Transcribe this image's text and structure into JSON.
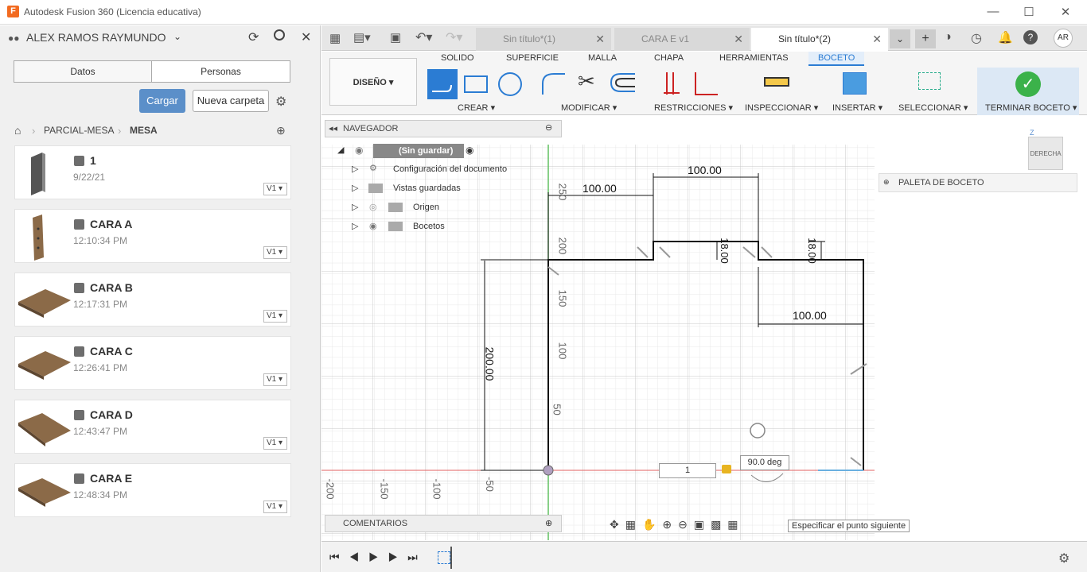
{
  "window": {
    "title": "Autodesk Fusion 360 (Licencia educativa)",
    "logo": "F",
    "minimize": "—",
    "maximize": "☐",
    "close": "✕"
  },
  "data_panel": {
    "user": "ALEX RAMOS RAYMUNDO",
    "tab_data": "Datos",
    "tab_people": "Personas",
    "upload": "Cargar",
    "new_folder": "Nueva carpeta",
    "breadcrumb": [
      "PARCIAL-MESA",
      "MESA"
    ],
    "items": [
      {
        "name": "1",
        "time": "9/22/21",
        "version": "V1"
      },
      {
        "name": "CARA A",
        "time": "12:10:34 PM",
        "version": "V1"
      },
      {
        "name": "CARA B",
        "time": "12:17:31 PM",
        "version": "V1"
      },
      {
        "name": "CARA C",
        "time": "12:26:41 PM",
        "version": "V1"
      },
      {
        "name": "CARA D",
        "time": "12:43:47 PM",
        "version": "V1"
      },
      {
        "name": "CARA E",
        "time": "12:48:34 PM",
        "version": "V1"
      }
    ]
  },
  "tabs": [
    {
      "label": "Sin título*(1)"
    },
    {
      "label": "CARA E v1"
    },
    {
      "label": "Sin título*(2)"
    }
  ],
  "user_initials": "AR",
  "ribbon": {
    "workspace": "DISEÑO",
    "tabs": [
      "SOLIDO",
      "SUPERFICIE",
      "MALLA",
      "CHAPA",
      "HERRAMIENTAS",
      "BOCETO"
    ],
    "groups": [
      "CREAR",
      "MODIFICAR",
      "RESTRICCIONES",
      "INSPECCIONAR",
      "INSERTAR",
      "SELECCIONAR",
      "TERMINAR BOCETO"
    ]
  },
  "browser": {
    "title": "NAVEGADOR",
    "root": "(Sin guardar)",
    "nodes": [
      "Configuración del documento",
      "Vistas guardadas",
      "Origen",
      "Bocetos"
    ]
  },
  "sketch_palette": "PALETA DE BOCETO",
  "viewcube": {
    "face": "DERECHA",
    "axis": "Z"
  },
  "dimensions": {
    "d1": "100.00",
    "d2": "100.00",
    "d3": "18.00",
    "d4": "18.00",
    "d5": "100.00",
    "d6": "200.00"
  },
  "axis_ticks_v": [
    "250",
    "200",
    "150",
    "100",
    "50"
  ],
  "axis_ticks_h": [
    "-200",
    "-150",
    "-100",
    "-50"
  ],
  "input": {
    "length": "1",
    "angle": "90.0 deg"
  },
  "comments": "COMENTARIOS",
  "tooltip": "Especificar el punto siguiente"
}
